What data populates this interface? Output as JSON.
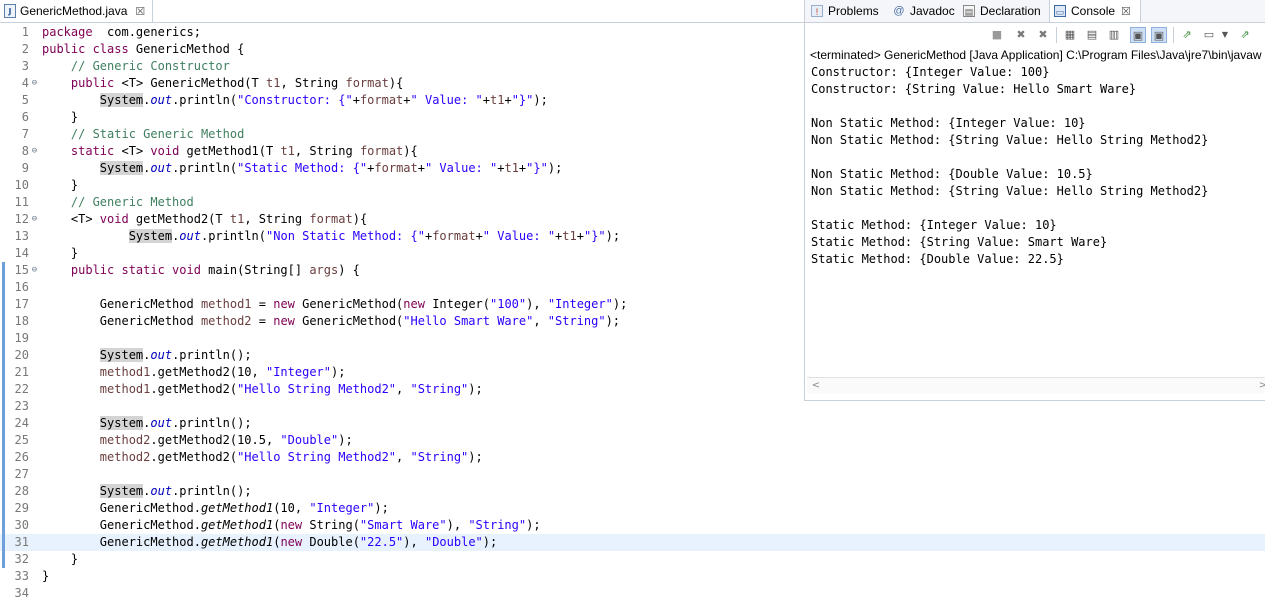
{
  "editor": {
    "tab": {
      "title": "GenericMethod.java",
      "icon": "java-file-icon",
      "close": "☒"
    },
    "lines": [
      {
        "n": "1",
        "segs": [
          [
            "kw",
            "package"
          ],
          [
            "",
            "  com.generics;"
          ]
        ]
      },
      {
        "n": "2",
        "segs": [
          [
            "kw",
            "public class"
          ],
          [
            "",
            " GenericMethod {"
          ]
        ]
      },
      {
        "n": "3",
        "segs": [
          [
            "",
            "    "
          ],
          [
            "cm",
            "// Generic Constructor"
          ]
        ]
      },
      {
        "n": "4",
        "fold": "⊖",
        "segs": [
          [
            "",
            "    "
          ],
          [
            "kw",
            "public"
          ],
          [
            "",
            " <T> GenericMethod(T "
          ],
          [
            "var",
            "t1"
          ],
          [
            "",
            ", String "
          ],
          [
            "var",
            "format"
          ],
          [
            "",
            ")"
          ],
          [
            "",
            "{"
          ]
        ]
      },
      {
        "n": "5",
        "segs": [
          [
            "",
            "        "
          ],
          [
            "sys",
            "System"
          ],
          [
            "",
            "."
          ],
          [
            "fld it",
            "out"
          ],
          [
            "",
            ".println("
          ],
          [
            "str",
            "\"Constructor: {\""
          ],
          [
            "",
            "+"
          ],
          [
            "var",
            "format"
          ],
          [
            "",
            "+"
          ],
          [
            "str",
            "\" Value: \""
          ],
          [
            "",
            "+"
          ],
          [
            "var",
            "t1"
          ],
          [
            "",
            "+"
          ],
          [
            "str",
            "\"}\""
          ],
          [
            "",
            ");"
          ]
        ]
      },
      {
        "n": "6",
        "segs": [
          [
            "",
            "    }"
          ]
        ]
      },
      {
        "n": "7",
        "segs": [
          [
            "",
            "    "
          ],
          [
            "cm",
            "// Static Generic Method"
          ]
        ]
      },
      {
        "n": "8",
        "fold": "⊖",
        "segs": [
          [
            "",
            "    "
          ],
          [
            "kw",
            "static"
          ],
          [
            "",
            " <T> "
          ],
          [
            "kw",
            "void"
          ],
          [
            "",
            " getMethod1(T "
          ],
          [
            "var",
            "t1"
          ],
          [
            "",
            ", String "
          ],
          [
            "var",
            "format"
          ],
          [
            "",
            ")"
          ],
          [
            "",
            "{"
          ]
        ]
      },
      {
        "n": "9",
        "segs": [
          [
            "",
            "        "
          ],
          [
            "sys",
            "System"
          ],
          [
            "",
            "."
          ],
          [
            "fld it",
            "out"
          ],
          [
            "",
            ".println("
          ],
          [
            "str",
            "\"Static Method: {\""
          ],
          [
            "",
            "+"
          ],
          [
            "var",
            "format"
          ],
          [
            "",
            "+"
          ],
          [
            "str",
            "\" Value: \""
          ],
          [
            "",
            "+"
          ],
          [
            "var",
            "t1"
          ],
          [
            "",
            "+"
          ],
          [
            "str",
            "\"}\""
          ],
          [
            "",
            ");"
          ]
        ]
      },
      {
        "n": "10",
        "segs": [
          [
            "",
            "    }"
          ]
        ]
      },
      {
        "n": "11",
        "segs": [
          [
            "",
            "    "
          ],
          [
            "cm",
            "// Generic Method"
          ]
        ]
      },
      {
        "n": "12",
        "fold": "⊖",
        "segs": [
          [
            "",
            "    <T> "
          ],
          [
            "kw",
            "void"
          ],
          [
            "",
            " getMethod2(T "
          ],
          [
            "var",
            "t1"
          ],
          [
            "",
            ", String "
          ],
          [
            "var",
            "format"
          ],
          [
            "",
            ")"
          ],
          [
            "",
            "{"
          ]
        ]
      },
      {
        "n": "13",
        "segs": [
          [
            "",
            "            "
          ],
          [
            "sys",
            "System"
          ],
          [
            "",
            "."
          ],
          [
            "fld it",
            "out"
          ],
          [
            "",
            ".println("
          ],
          [
            "str",
            "\"Non Static Method: {\""
          ],
          [
            "",
            "+"
          ],
          [
            "var",
            "format"
          ],
          [
            "",
            "+"
          ],
          [
            "str",
            "\" Value: \""
          ],
          [
            "",
            "+"
          ],
          [
            "var",
            "t1"
          ],
          [
            "",
            "+"
          ],
          [
            "str",
            "\"}\""
          ],
          [
            "",
            ");"
          ]
        ]
      },
      {
        "n": "14",
        "segs": [
          [
            "",
            "    }"
          ]
        ]
      },
      {
        "n": "15",
        "fold": "⊖",
        "marker": true,
        "segs": [
          [
            "",
            "    "
          ],
          [
            "kw",
            "public static void"
          ],
          [
            "",
            " main(String[] "
          ],
          [
            "var",
            "args"
          ],
          [
            "",
            ") {"
          ]
        ]
      },
      {
        "n": "16",
        "marker": true,
        "segs": []
      },
      {
        "n": "17",
        "marker": true,
        "segs": [
          [
            "",
            "        GenericMethod "
          ],
          [
            "var",
            "method1"
          ],
          [
            "",
            " = "
          ],
          [
            "kw",
            "new"
          ],
          [
            "",
            " GenericMethod("
          ],
          [
            "kw",
            "new"
          ],
          [
            "",
            " Integer("
          ],
          [
            "str",
            "\"100\""
          ],
          [
            "",
            "), "
          ],
          [
            "str",
            "\"Integer\""
          ],
          [
            "",
            ");"
          ]
        ]
      },
      {
        "n": "18",
        "marker": true,
        "segs": [
          [
            "",
            "        GenericMethod "
          ],
          [
            "var",
            "method2"
          ],
          [
            "",
            " = "
          ],
          [
            "kw",
            "new"
          ],
          [
            "",
            " GenericMethod("
          ],
          [
            "str",
            "\"Hello Smart Ware\""
          ],
          [
            "",
            ", "
          ],
          [
            "str",
            "\"String\""
          ],
          [
            "",
            ");"
          ]
        ]
      },
      {
        "n": "19",
        "marker": true,
        "segs": []
      },
      {
        "n": "20",
        "marker": true,
        "segs": [
          [
            "",
            "        "
          ],
          [
            "sys",
            "System"
          ],
          [
            "",
            "."
          ],
          [
            "fld it",
            "out"
          ],
          [
            "",
            ".println();"
          ]
        ]
      },
      {
        "n": "21",
        "marker": true,
        "segs": [
          [
            "",
            "        "
          ],
          [
            "var",
            "method1"
          ],
          [
            "",
            ".getMethod2(10, "
          ],
          [
            "str",
            "\"Integer\""
          ],
          [
            "",
            ");"
          ]
        ]
      },
      {
        "n": "22",
        "marker": true,
        "segs": [
          [
            "",
            "        "
          ],
          [
            "var",
            "method1"
          ],
          [
            "",
            ".getMethod2("
          ],
          [
            "str",
            "\"Hello String Method2\""
          ],
          [
            "",
            ", "
          ],
          [
            "str",
            "\"String\""
          ],
          [
            "",
            ");"
          ]
        ]
      },
      {
        "n": "23",
        "marker": true,
        "segs": []
      },
      {
        "n": "24",
        "marker": true,
        "segs": [
          [
            "",
            "        "
          ],
          [
            "sys",
            "System"
          ],
          [
            "",
            "."
          ],
          [
            "fld it",
            "out"
          ],
          [
            "",
            ".println();"
          ]
        ]
      },
      {
        "n": "25",
        "marker": true,
        "segs": [
          [
            "",
            "        "
          ],
          [
            "var",
            "method2"
          ],
          [
            "",
            ".getMethod2(10.5, "
          ],
          [
            "str",
            "\"Double\""
          ],
          [
            "",
            ");"
          ]
        ]
      },
      {
        "n": "26",
        "marker": true,
        "segs": [
          [
            "",
            "        "
          ],
          [
            "var",
            "method2"
          ],
          [
            "",
            ".getMethod2("
          ],
          [
            "str",
            "\"Hello String Method2\""
          ],
          [
            "",
            ", "
          ],
          [
            "str",
            "\"String\""
          ],
          [
            "",
            ");"
          ]
        ]
      },
      {
        "n": "27",
        "marker": true,
        "segs": []
      },
      {
        "n": "28",
        "marker": true,
        "segs": [
          [
            "",
            "        "
          ],
          [
            "sys",
            "System"
          ],
          [
            "",
            "."
          ],
          [
            "fld it",
            "out"
          ],
          [
            "",
            ".println();"
          ]
        ]
      },
      {
        "n": "29",
        "marker": true,
        "segs": [
          [
            "",
            "        GenericMethod."
          ],
          [
            "it",
            "getMethod1"
          ],
          [
            "",
            "(10, "
          ],
          [
            "str",
            "\"Integer\""
          ],
          [
            "",
            ");"
          ]
        ]
      },
      {
        "n": "30",
        "marker": true,
        "segs": [
          [
            "",
            "        GenericMethod."
          ],
          [
            "it",
            "getMethod1"
          ],
          [
            "",
            "("
          ],
          [
            "kw",
            "new"
          ],
          [
            "",
            " String("
          ],
          [
            "str",
            "\"Smart Ware\""
          ],
          [
            "",
            "), "
          ],
          [
            "str",
            "\"String\""
          ],
          [
            "",
            ");"
          ]
        ]
      },
      {
        "n": "31",
        "marker": true,
        "current": true,
        "segs": [
          [
            "",
            "        GenericMethod."
          ],
          [
            "it",
            "getMethod1"
          ],
          [
            "",
            "("
          ],
          [
            "kw",
            "new"
          ],
          [
            "",
            " Double("
          ],
          [
            "str",
            "\"22.5\""
          ],
          [
            "",
            "), "
          ],
          [
            "str",
            "\"Double\""
          ],
          [
            "",
            ");"
          ]
        ]
      },
      {
        "n": "32",
        "marker": true,
        "segs": [
          [
            "",
            "    }"
          ]
        ]
      },
      {
        "n": "33",
        "segs": [
          [
            "",
            "}"
          ]
        ]
      },
      {
        "n": "34",
        "segs": []
      }
    ]
  },
  "console_panel": {
    "tabs": [
      {
        "label": "Problems",
        "icon": "problems-icon",
        "active": false
      },
      {
        "label": "Javadoc",
        "icon": "at-icon",
        "active": false
      },
      {
        "label": "Declaration",
        "icon": "declaration-icon",
        "active": false
      },
      {
        "label": "Console",
        "icon": "console-icon",
        "active": true,
        "close": "☒"
      }
    ],
    "status": "<terminated> GenericMethod [Java Application] C:\\Program Files\\Java\\jre7\\bin\\javaw",
    "output": [
      "Constructor: {Integer Value: 100}",
      "Constructor: {String Value: Hello Smart Ware}",
      "",
      "Non Static Method: {Integer Value: 10}",
      "Non Static Method: {String Value: Hello String Method2}",
      "",
      "Non Static Method: {Double Value: 10.5}",
      "Non Static Method: {String Value: Hello String Method2}",
      "",
      "Static Method: {Integer Value: 10}",
      "Static Method: {String Value: Smart Ware}",
      "Static Method: {Double Value: 22.5}"
    ],
    "scroll_left": "<",
    "scroll_right": ">"
  }
}
